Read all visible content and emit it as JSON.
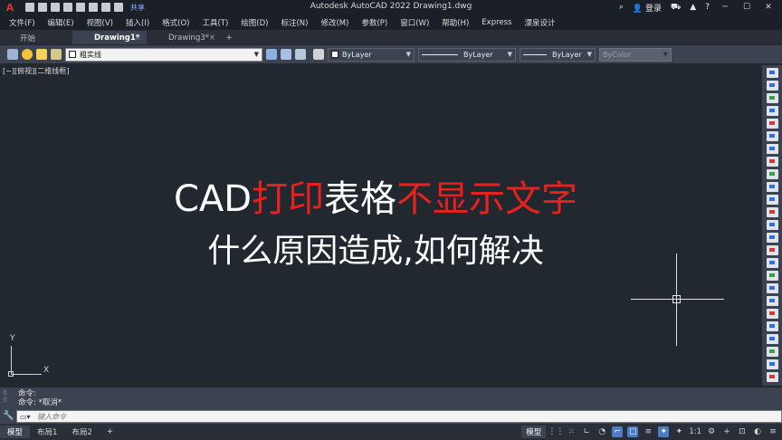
{
  "app": {
    "logo": "A",
    "title": "Autodesk AutoCAD 2022    Drawing1.dwg",
    "share_label": "共享",
    "login_label": "登录",
    "help_label": "?"
  },
  "menu": [
    "文件(F)",
    "编辑(E)",
    "视图(V)",
    "插入(I)",
    "格式(O)",
    "工具(T)",
    "绘图(D)",
    "标注(N)",
    "修改(M)",
    "参数(P)",
    "窗口(W)",
    "帮助(H)",
    "Express",
    "漂泉设计"
  ],
  "tabs": {
    "start": "开始",
    "items": [
      {
        "label": "Drawing1*",
        "active": true
      },
      {
        "label": "Drawing3*",
        "active": false
      }
    ],
    "plus": "+",
    "close": "×"
  },
  "toolbar": {
    "layer_value": "粗实线",
    "color_value": "ByLayer",
    "linetype_value": "ByLayer",
    "lineweight_value": "ByLayer",
    "plotstyle_value": "ByColor"
  },
  "viewport": {
    "view_label": "[−][俯视][二维线框]",
    "headline1_white_a": "CAD",
    "headline1_red_a": "打印",
    "headline1_white_b": "表格",
    "headline1_red_b": "不显示文字",
    "headline2": "什么原因造成,如何解决",
    "ucs_x": "X",
    "ucs_y": "Y"
  },
  "command": {
    "history": [
      "命令:",
      "命令: *取消*"
    ],
    "placeholder": "键入命令"
  },
  "status": {
    "layouts": [
      "模型",
      "布局1",
      "布局2"
    ],
    "add": "+",
    "model_label": "模型",
    "scale": "1:1"
  },
  "colors": {
    "accent_red": "#e8211d",
    "background": "#212830"
  }
}
